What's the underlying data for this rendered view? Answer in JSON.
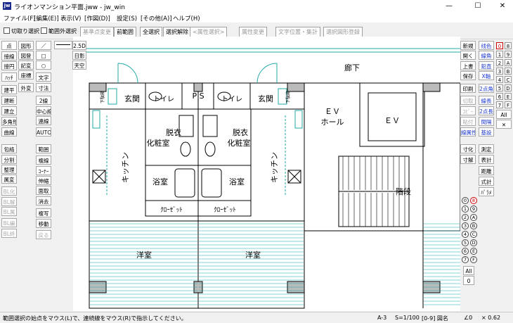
{
  "window": {
    "title": "ライオンマンション平面.jww - jw_win",
    "icon_label": "jw"
  },
  "window_controls": {
    "minimize": "—",
    "maximize": "☐",
    "close": "✕"
  },
  "menu": [
    "ファイル(F)",
    "[編集(E)]",
    "表示(V)",
    "[作図(D)]",
    "設定(S)",
    "[その他(A)]",
    "ヘルプ(H)"
  ],
  "toolbar": {
    "crop_select": "切取り選択",
    "outside_select": "範囲外選択",
    "base_change": "基準点変更",
    "prev_range": "前範囲",
    "select_all": "全選択",
    "deselect": "選択解除",
    "attr_select": "<属性選択>",
    "attr_change": "属性変更",
    "text_pos": "文字位置・集計",
    "select_register": "選択図形登録"
  },
  "left_tools_col1": [
    "点",
    "接線",
    "接円",
    "ﾊｯﾁ",
    "建平",
    "建断",
    "建立",
    "多角形",
    "曲線",
    "包絡",
    "分割",
    "整理",
    "属変",
    "BL化",
    "BL解",
    "BL属",
    "BL編",
    "BL終"
  ],
  "left_tools_col2": [
    "図形",
    "図登",
    "記変",
    "座標",
    "外変"
  ],
  "left_tools_col2b": [
    "／",
    "□",
    "○",
    "文字",
    "寸法",
    "2線",
    "中心線",
    "連線",
    "AUTO",
    "範囲",
    "複線",
    "ｺｰﾅｰ",
    "伸縮",
    "面取",
    "消去",
    "複写",
    "移動",
    "戻る"
  ],
  "view_tools": [
    "2.5D",
    "日影",
    "天空"
  ],
  "right_tools_col1": [
    "新規",
    "開く",
    "上書",
    "保存",
    "印刷",
    "切取",
    "ｺﾋﾟｰ",
    "貼付",
    "線属性"
  ],
  "right_tools_col2": [
    "线色",
    "線角",
    "鉛直",
    "X軸",
    "2点角",
    "線長",
    "2点長",
    "間隔",
    "基設"
  ],
  "right_tools_lower": {
    "dimension": [
      "寸化",
      "寸解",
      "測定",
      "表計",
      "距離"
    ],
    "other": [
      "式計",
      "ﾊﾟﾗﾒ"
    ]
  },
  "layer_buttons": [
    "0",
    "8",
    "1",
    "9",
    "2",
    "A",
    "3",
    "B",
    "4",
    "C",
    "5",
    "D",
    "6",
    "E",
    "7",
    "F"
  ],
  "layer_all": "All",
  "layer_x": "✕",
  "group_buttons": [
    "0",
    "8",
    "1",
    "9",
    "2",
    "A",
    "3",
    "B",
    "4",
    "C",
    "5",
    "D",
    "6",
    "E",
    "7",
    "F"
  ],
  "group_all": "All",
  "group_zero": "0",
  "plan": {
    "corridor": "廊下",
    "entrance_left": "玄関",
    "toilet_left": "トイレ",
    "ps": "P S",
    "toilet_right": "トイレ",
    "entrance_right": "玄関",
    "ev_hall_1": "ＥＶ",
    "ev_hall_2": "ホール",
    "ev": "ＥＶ",
    "dress_1": "脱衣",
    "dress_2": "化粧室",
    "kitchen": "キッチン",
    "bath": "浴室",
    "stairs": "階段",
    "closet": "ｸﾛｰｾﾞｯﾄ",
    "western_room": "洋室",
    "shoebox": "下駄箱"
  },
  "status": {
    "message": "範囲選択の始点をマウス(L)で、連続線をマウス(R)で指示してください。",
    "paper": "A-3",
    "scale": "S=1/100",
    "layer": "[0-9] 図名",
    "angle": "∠0",
    "zoom": "× 0.62"
  }
}
